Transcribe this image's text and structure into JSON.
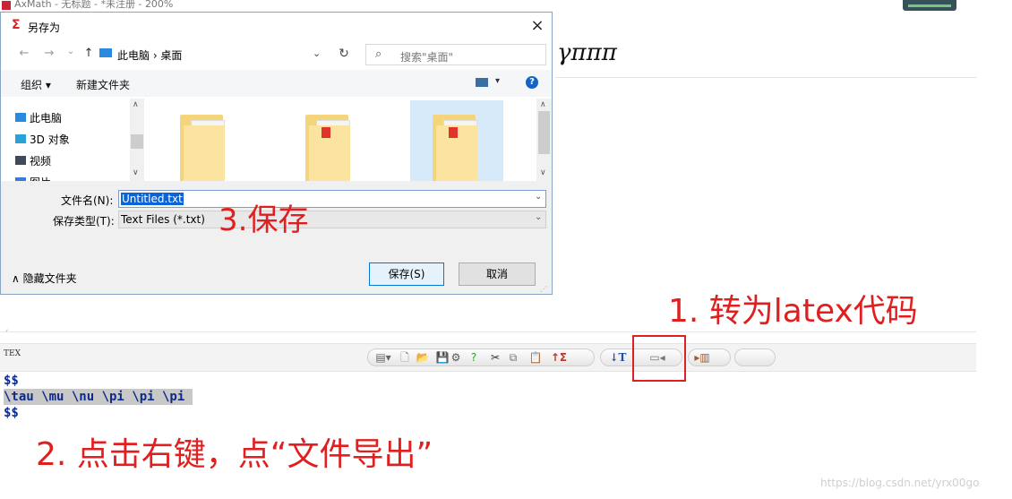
{
  "app": {
    "title": "AxMath - 无标题 - *未注册 - 200%",
    "math_preview": "γπππ"
  },
  "dialog": {
    "title_icon": "Σ",
    "title": "另存为",
    "close": "×",
    "nav": {
      "back": "←",
      "forward": "→",
      "recent": "⌄",
      "up": "↑",
      "path": "此电脑 › 桌面",
      "dropdown": "⌄",
      "refresh": "↻"
    },
    "search": {
      "icon": "search-icon",
      "placeholder": "搜索\"桌面\""
    },
    "toolbar": {
      "organize": "组织 ▾",
      "new_folder": "新建文件夹",
      "view_dd": "▾",
      "help": "?"
    },
    "nav_pane": {
      "items": [
        {
          "label": "此电脑",
          "icon": "computer-icon",
          "color": "#2a8ae0"
        },
        {
          "label": "3D 对象",
          "icon": "cube-icon",
          "color": "#29a3d6"
        },
        {
          "label": "视频",
          "icon": "video-icon",
          "color": "#404a5a"
        },
        {
          "label": "图片",
          "icon": "pictures-icon",
          "color": "#3a7bd5"
        }
      ]
    },
    "filename_label": "文件名(N):",
    "filename_value": "Untitled.txt",
    "type_label": "保存类型(T):",
    "type_value": "Text Files (*.txt)",
    "hide_folders": "∧ 隐藏文件夹",
    "save": "保存(S)",
    "cancel": "取消"
  },
  "annotations": {
    "step1": "1. 转为latex代码",
    "step2": "2. 点击右键，点“文件导出”",
    "step3": "3.保存"
  },
  "latex_toolbar": {
    "label": "TEX",
    "buttons": [
      {
        "name": "format-icon",
        "glyph": "▤▾",
        "color": "#666"
      },
      {
        "name": "new-file-icon",
        "glyph": "🗋",
        "color": "#777"
      },
      {
        "name": "open-folder-icon",
        "glyph": "📂",
        "color": "#d9a322"
      },
      {
        "name": "save-disk-icon",
        "glyph": "💾",
        "color": "#2c3e8c"
      },
      {
        "name": "gear-icon",
        "glyph": "⚙",
        "color": "#555"
      },
      {
        "name": "help-icon",
        "glyph": "?",
        "color": "#2aa52a"
      },
      {
        "name": "cut-icon",
        "glyph": "✂",
        "color": "#333"
      },
      {
        "name": "copy-icon",
        "glyph": "⧉",
        "color": "#777"
      },
      {
        "name": "paste-icon",
        "glyph": "📋",
        "color": "#777"
      },
      {
        "name": "to-axmath-icon",
        "glyph": "↑Σ",
        "color": "#c0392b"
      },
      {
        "name": "to-latex-icon",
        "glyph": "↓T",
        "color": "#1f4fa8"
      },
      {
        "name": "panel-left-icon",
        "glyph": "▭◂",
        "color": "#777"
      },
      {
        "name": "import-icon",
        "glyph": "▸▥",
        "color": "#a05a2c"
      }
    ]
  },
  "code": [
    "$$",
    "\\tau \\mu \\nu \\pi \\pi \\pi ",
    "$$"
  ],
  "watermark": "https://blog.csdn.net/yrx00go"
}
